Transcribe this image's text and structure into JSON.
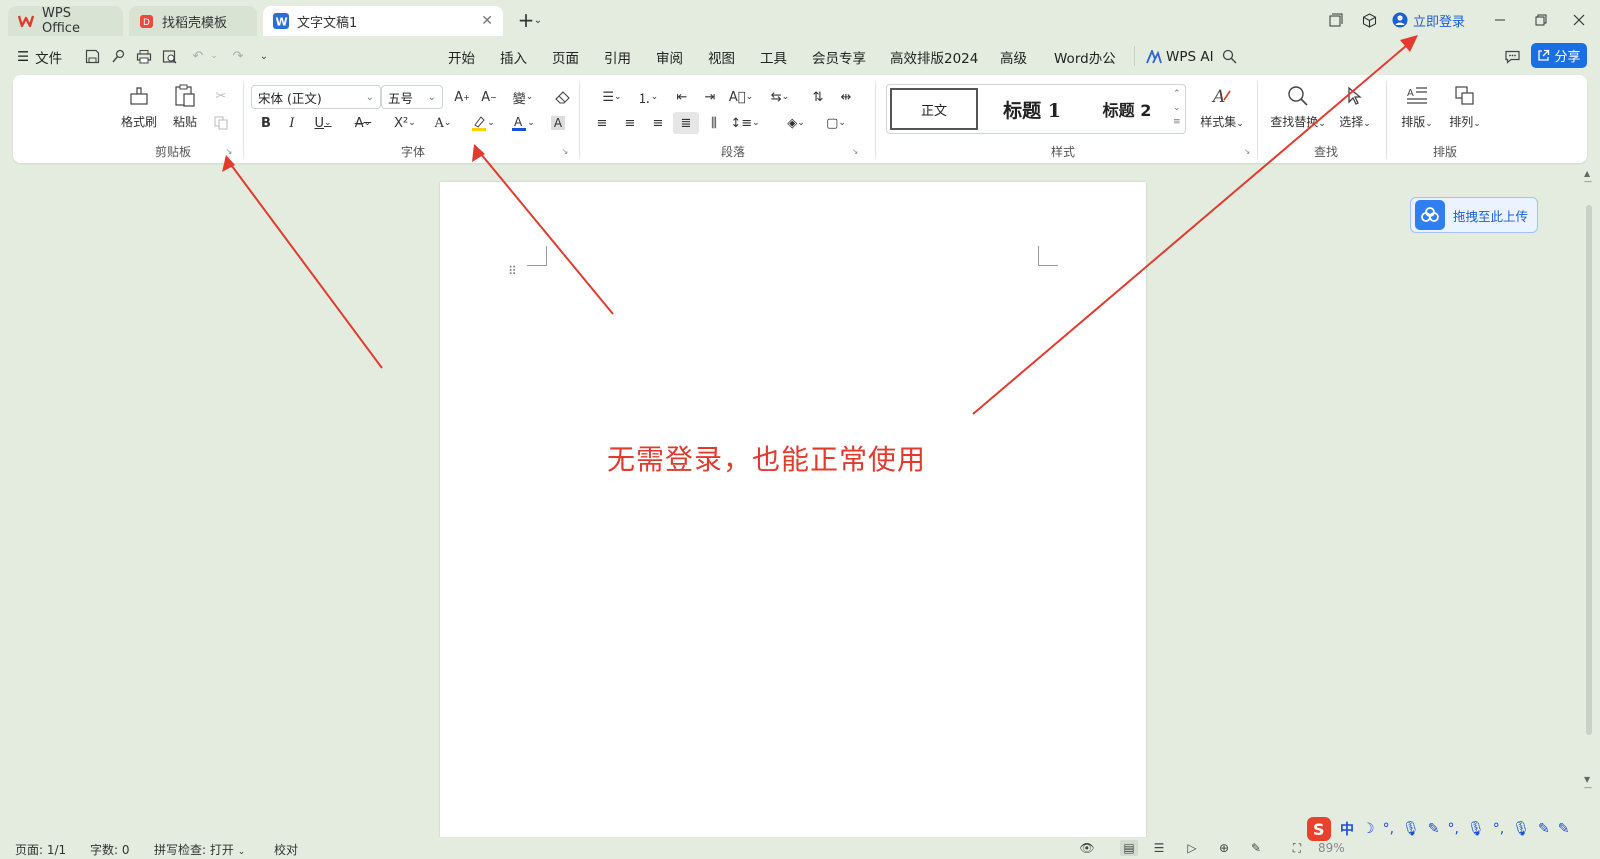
{
  "tabs": [
    {
      "label": "WPS Office",
      "icon": "wps-logo-icon"
    },
    {
      "label": "找稻壳模板",
      "icon": "docer-icon"
    },
    {
      "label": "文字文稿1",
      "icon": "word-doc-icon",
      "active": true
    }
  ],
  "titlebar": {
    "login_label": "立即登录"
  },
  "menubar": {
    "file_label": "文件",
    "tabs": [
      "开始",
      "插入",
      "页面",
      "引用",
      "审阅",
      "视图",
      "工具",
      "会员专享",
      "高效排版2024",
      "高级",
      "Word办公"
    ],
    "active_tab": "开始",
    "wps_ai_label": "WPS AI",
    "share_label": "分享"
  },
  "ribbon": {
    "clipboard": {
      "format_painter": "格式刷",
      "paste": "粘贴",
      "group_label": "剪贴板"
    },
    "font": {
      "font_name": "宋体 (正文)",
      "font_size": "五号",
      "group_label": "字体"
    },
    "paragraph": {
      "group_label": "段落"
    },
    "styles": {
      "normal": "正文",
      "heading1": "标题 1",
      "heading2": "标题 2",
      "style_set": "样式集",
      "group_label": "样式"
    },
    "find": {
      "find_replace": "查找替换",
      "select": "选择",
      "group_label": "查找"
    },
    "arrange": {
      "layout": "排版",
      "arrange": "排列",
      "group_label": "排版"
    }
  },
  "document": {
    "annotation": "无需登录，也能正常使用",
    "upload_label": "拖拽至此上传"
  },
  "statusbar": {
    "page": "页面: 1/1",
    "words": "字数: 0",
    "spellcheck": "拼写检查: 打开",
    "proofread": "校对",
    "zoom": "89%"
  },
  "ime": {
    "label": "中"
  },
  "colors": {
    "accent": "#1a5fd6",
    "annotation_red": "#e23b2e",
    "background": "#e4ecdf"
  }
}
